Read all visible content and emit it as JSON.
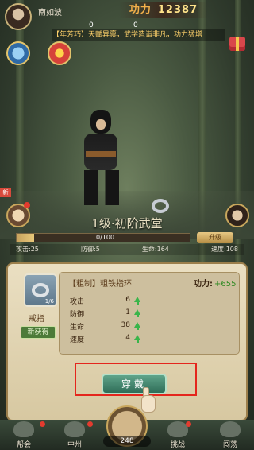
{
  "player": {
    "name": "南如波"
  },
  "hud": {
    "power_prefix": "功力",
    "power_value": "12387",
    "stat_left": "0",
    "stat_right": "0",
    "notice": "【年芳巧】天赋异禀，武学造诣非凡，功力猛增"
  },
  "side_left_badge": "新",
  "stage": {
    "name": "1级·初阶武堂",
    "progress_text": "10/100",
    "progress_fraction": 0.1,
    "upgrade_label": "升级",
    "stats": [
      "攻击:25",
      "防御:5",
      "生命:164",
      "速度:108"
    ]
  },
  "popup": {
    "slot_count": "1/6",
    "slot_name": "戒指",
    "new_tag": "新获得",
    "item_title": "【粗制】粗铁指环",
    "power_label": "功力:",
    "power_delta": "+655",
    "stats": [
      {
        "name": "攻击",
        "value": "6"
      },
      {
        "name": "防御",
        "value": "1"
      },
      {
        "name": "生命",
        "value": "38"
      },
      {
        "name": "速度",
        "value": "4"
      }
    ],
    "equip_label": "穿戴"
  },
  "nav": {
    "items": [
      {
        "label": "帮会",
        "icon": "guild-icon"
      },
      {
        "label": "中州",
        "icon": "map-icon"
      },
      {
        "label": "挑战",
        "icon": "challenge-icon"
      },
      {
        "label": "闯荡",
        "icon": "adventure-icon"
      }
    ],
    "center_count": "248"
  },
  "colors": {
    "accent_gold": "#e7c884",
    "power_green": "#2f8a23",
    "highlight_red": "#e4261d",
    "equip_green": "#2f6d58"
  }
}
